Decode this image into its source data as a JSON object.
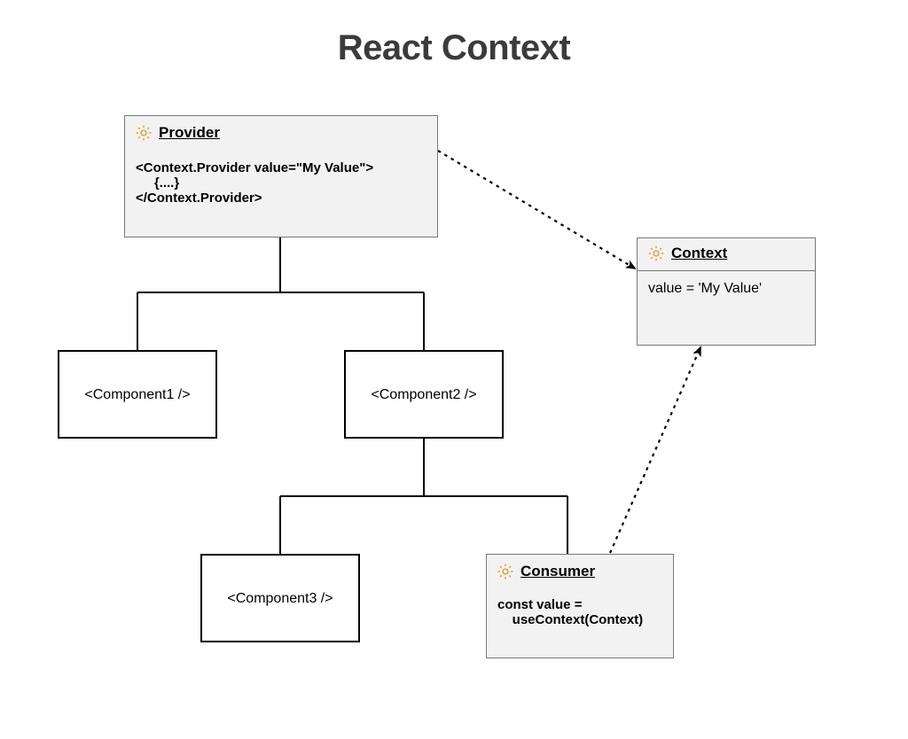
{
  "title": "React Context",
  "provider": {
    "label": "Provider",
    "code_line1": "<Context.Provider value=\"My Value\">",
    "code_line2": "     {....}",
    "code_line3": "</Context.Provider>"
  },
  "context": {
    "label": "Context",
    "body": "value = 'My Value'"
  },
  "component1": {
    "label": "<Component1 />"
  },
  "component2": {
    "label": "<Component2 />"
  },
  "component3": {
    "label": "<Component3 />"
  },
  "consumer": {
    "label": "Consumer",
    "code_line1": "const value =",
    "code_line2": "    useContext(Context)"
  }
}
